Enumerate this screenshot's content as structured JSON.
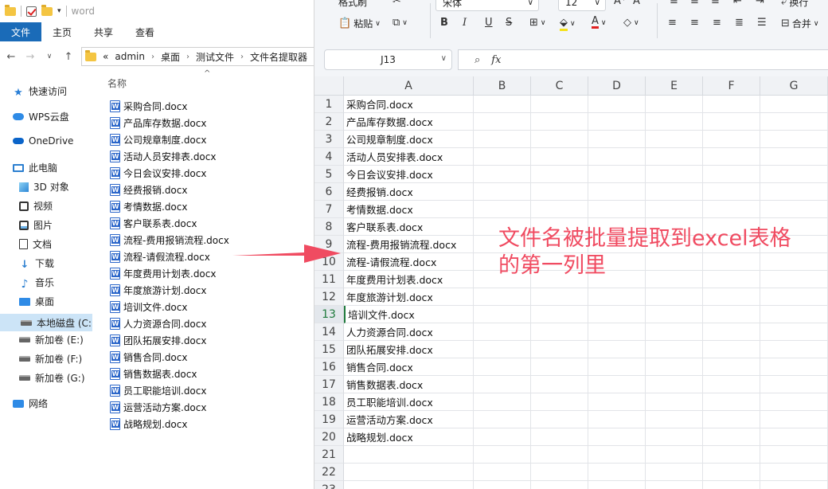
{
  "explorer": {
    "title": "word",
    "ribbon_tabs": [
      "文件",
      "主页",
      "共享",
      "查看"
    ],
    "address": {
      "overflow": "«",
      "crumbs": [
        "admin",
        "桌面",
        "测试文件",
        "文件名提取器"
      ]
    },
    "column_header": "名称",
    "sort_indicator": "^",
    "nav": [
      {
        "label": "快速访问",
        "icon": "star-icon"
      },
      {
        "label": "WPS云盘",
        "icon": "cloud-icon"
      },
      {
        "label": "OneDrive",
        "icon": "onedrive-icon"
      },
      {
        "label": "此电脑",
        "icon": "pc-icon"
      },
      {
        "label": "3D 对象",
        "icon": "cube-icon"
      },
      {
        "label": "视频",
        "icon": "video-icon"
      },
      {
        "label": "图片",
        "icon": "picture-icon"
      },
      {
        "label": "文档",
        "icon": "document-icon"
      },
      {
        "label": "下载",
        "icon": "download-icon"
      },
      {
        "label": "音乐",
        "icon": "music-icon"
      },
      {
        "label": "桌面",
        "icon": "desktop-icon"
      },
      {
        "label": "本地磁盘 (C:",
        "icon": "disk-icon"
      },
      {
        "label": "新加卷 (E:)",
        "icon": "disk-icon"
      },
      {
        "label": "新加卷 (F:)",
        "icon": "disk-icon"
      },
      {
        "label": "新加卷 (G:)",
        "icon": "disk-icon"
      },
      {
        "label": "网络",
        "icon": "network-icon"
      }
    ],
    "files": [
      "采购合同.docx",
      "产品库存数据.docx",
      "公司规章制度.docx",
      "活动人员安排表.docx",
      "今日会议安排.docx",
      "经费报销.docx",
      "考情数据.docx",
      "客户联系表.docx",
      "流程-费用报销流程.docx",
      "流程-请假流程.docx",
      "年度费用计划表.docx",
      "年度旅游计划.docx",
      "培训文件.docx",
      "人力资源合同.docx",
      "团队拓展安排.docx",
      "销售合同.docx",
      "销售数据表.docx",
      "员工职能培训.docx",
      "运营活动方案.docx",
      "战略规划.docx"
    ]
  },
  "spreadsheet": {
    "toolbar": {
      "format_painter": "格式刷",
      "paste": "粘贴",
      "font_name": "宋体",
      "font_size": "12",
      "wrap": "换行",
      "merge": "合并"
    },
    "name_box": "J13",
    "columns": [
      "A",
      "B",
      "C",
      "D",
      "E",
      "F",
      "G"
    ],
    "rows": [
      "采购合同.docx",
      "产品库存数据.docx",
      "公司规章制度.docx",
      "活动人员安排表.docx",
      "今日会议安排.docx",
      "经费报销.docx",
      "考情数据.docx",
      "客户联系表.docx",
      "流程-费用报销流程.docx",
      "流程-请假流程.docx",
      "年度费用计划表.docx",
      "年度旅游计划.docx",
      "培训文件.docx",
      "人力资源合同.docx",
      "团队拓展安排.docx",
      "销售合同.docx",
      "销售数据表.docx",
      "员工职能培训.docx",
      "运营活动方案.docx",
      "战略规划.docx",
      "",
      "",
      ""
    ],
    "active_row": 13
  },
  "annotation": {
    "line1": "文件名被批量提取到excel表格",
    "line2": "的第一列里",
    "color": "#f04b61"
  }
}
